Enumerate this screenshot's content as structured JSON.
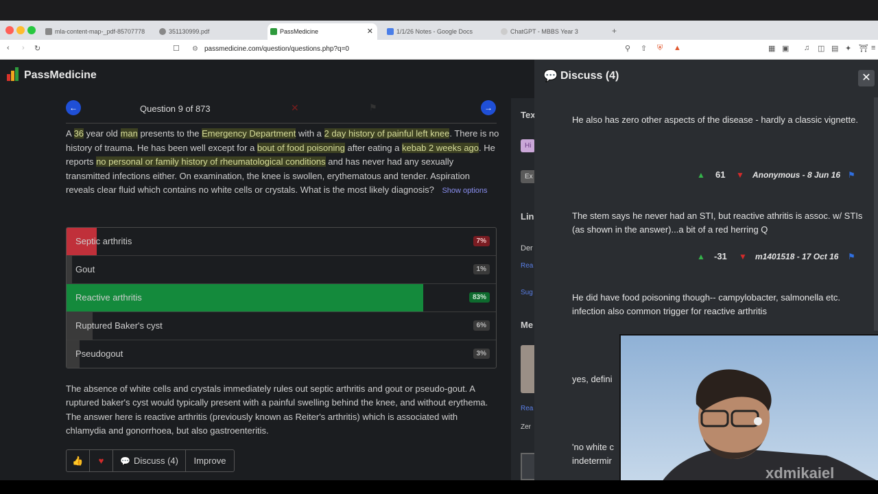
{
  "browser": {
    "tabs": [
      {
        "label": "mla-content-map-_pdf-85707778",
        "active": false
      },
      {
        "label": "351130999.pdf",
        "active": false
      },
      {
        "label": "PassMedicine",
        "active": true
      },
      {
        "label": "1/1/26 Notes - Google Docs",
        "active": false
      },
      {
        "label": "ChatGPT - MBBS Year 3",
        "active": false
      }
    ],
    "url": "passmedicine.com/question/questions.php?q=0",
    "colors": {
      "close": "#ff5f57",
      "minimize": "#febc2e",
      "maximize": "#28c840"
    }
  },
  "app": {
    "brand": "PassMedicine",
    "question_counter": "Question 9 of 873",
    "stem": [
      {
        "t": "A ",
        "h": false
      },
      {
        "t": "36",
        "h": true
      },
      {
        "t": " year old ",
        "h": false
      },
      {
        "t": "man",
        "h": true
      },
      {
        "t": " presents to the ",
        "h": false
      },
      {
        "t": "Emergency Department",
        "h": true
      },
      {
        "t": " with a ",
        "h": false
      },
      {
        "t": "2 day history of painful left knee",
        "h": true
      },
      {
        "t": ". There is no history of trauma. He has been well except for a ",
        "h": false
      },
      {
        "t": "bout of food poisoning",
        "h": true
      },
      {
        "t": " after eating a ",
        "h": false
      },
      {
        "t": "kebab 2 weeks ago",
        "h": true
      },
      {
        "t": ". He reports ",
        "h": false
      },
      {
        "t": "no personal or family history of rheumatological conditions",
        "h": true
      },
      {
        "t": " and has never had any sexually transmitted infections either. On examination, the knee is swollen, erythematous and tender. Aspiration reveals clear fluid which contains no white cells or crystals. What is the most likely diagnosis?",
        "h": false
      }
    ],
    "show_options": "Show options",
    "options": [
      {
        "label": "Septic arthritis",
        "pct": "7%",
        "fill": 0.07,
        "color": "#c0303a"
      },
      {
        "label": "Gout",
        "pct": "1%",
        "fill": 0.01,
        "color": "#3a3a3a"
      },
      {
        "label": "Reactive arthritis",
        "pct": "83%",
        "fill": 0.83,
        "color": "#148a3c"
      },
      {
        "label": "Ruptured Baker's cyst",
        "pct": "6%",
        "fill": 0.06,
        "color": "#3a3a3a"
      },
      {
        "label": "Pseudogout",
        "pct": "3%",
        "fill": 0.03,
        "color": "#3a3a3a"
      }
    ],
    "explanation": "The absence of white cells and crystals immediately rules out septic arthritis and gout or pseudo-gout. A ruptured baker's cyst would typically present with a painful swelling behind the knee, and without erythema. The answer here is reactive arthritis (previously known as Reiter's arthritis) which is associated with chlamydia and gonorrhoea, but also gastroenteritis.",
    "actions": {
      "discuss": "Discuss (4)",
      "improve": "Improve"
    },
    "side_fragments": {
      "tex": "Tex",
      "hi": "Hi",
      "ex": "Ex",
      "lin": "Lin",
      "der": "Der",
      "rea": "Rea",
      "sug": "Sug",
      "me": "Me",
      "rea2": "Rea",
      "zer": "Zer"
    }
  },
  "discuss": {
    "title": "Discuss (4)",
    "comments": [
      {
        "text": "He also has zero other aspects of the disease - hardly a classic vignette.",
        "votes": "61",
        "meta": "Anonymous - 8 Jun 16"
      },
      {
        "text": "The stem says he never had an STI, but reactive athritis is assoc. w/ STIs (as shown in the answer)...a bit of a red herring Q",
        "votes": "-31",
        "meta": "m1401518 - 17 Oct 16"
      },
      {
        "text": "He did have food poisoning though-- campylobacter, salmonella etc. infection also common trigger for reactive arthritis",
        "votes": "",
        "meta": ""
      },
      {
        "text": "yes, defini",
        "votes": "",
        "meta": ""
      },
      {
        "text": "'no white c",
        "votes": "",
        "meta": ""
      },
      {
        "text": "indetermir",
        "votes": "",
        "meta": ""
      }
    ]
  },
  "overlay": {
    "watermark": "xdmikaiel"
  }
}
